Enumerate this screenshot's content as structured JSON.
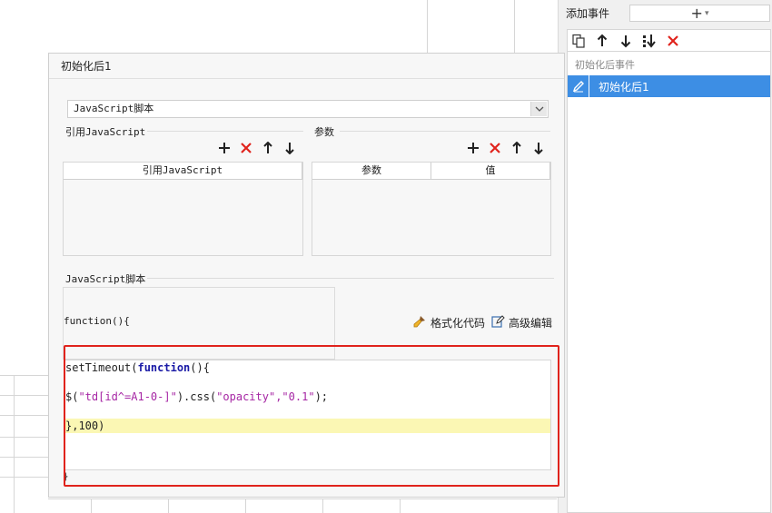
{
  "right_panel": {
    "add_event_label": "添加事件",
    "add_event_button": "+",
    "event_group_label": "初始化后事件",
    "event_item_label": "初始化后1"
  },
  "dialog": {
    "title": "初始化后1",
    "script_type": "JavaScript脚本",
    "ref_js_section": "引用JavaScript",
    "ref_js_column": "引用JavaScript",
    "params_section": "参数",
    "params_columns": [
      "参数",
      "值"
    ],
    "script_section": "JavaScript脚本",
    "function_header": "function(){",
    "format_code": "格式化代码",
    "advanced_edit": "高级编辑",
    "closing_brace": "}"
  },
  "code": {
    "line1_fn": "setTimeout(",
    "line1_kw": "function",
    "line1_end": "(){",
    "line2_a": "$(",
    "line2_str1": "\"td[id^=A1-0-]\"",
    "line2_b": ").css(",
    "line2_str2": "\"opacity\",\"0.1\"",
    "line2_c": ");",
    "line3": "},100)"
  },
  "colors": {
    "accent": "#3d8ee4",
    "outline": "#e0231c",
    "delete": "#e0231c",
    "highlight_line": "#fbf7b4"
  }
}
